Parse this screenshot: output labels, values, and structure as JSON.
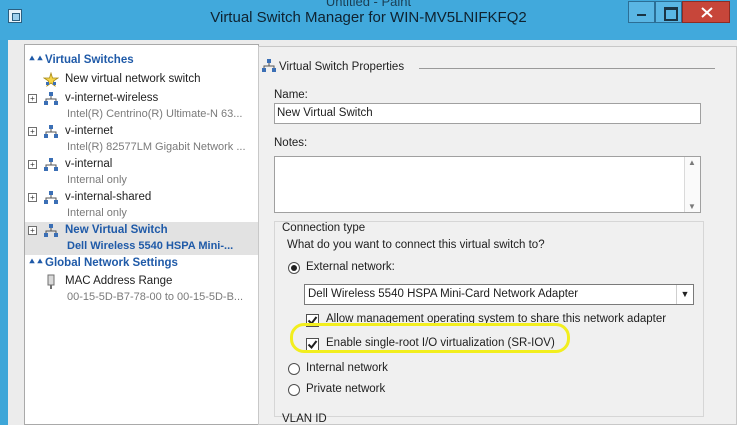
{
  "window": {
    "behind_title": "Untitled - Paint",
    "title": "Virtual Switch Manager for WIN-MV5LNIFKFQ2"
  },
  "sidebar": {
    "virtual_switches_header": "Virtual Switches",
    "new_switch_action": "New virtual network switch",
    "switches": [
      {
        "name": "v-internet-wireless",
        "detail": "Intel(R) Centrino(R) Ultimate-N 63..."
      },
      {
        "name": "v-internet",
        "detail": "Intel(R) 82577LM Gigabit Network ..."
      },
      {
        "name": "v-internal",
        "detail": "Internal only"
      },
      {
        "name": "v-internal-shared",
        "detail": "Internal only"
      },
      {
        "name": "New Virtual Switch",
        "detail": "Dell Wireless 5540 HSPA Mini-..."
      }
    ],
    "global_header": "Global Network Settings",
    "mac_range": {
      "name": "MAC Address Range",
      "detail": "00-15-5D-B7-78-00 to 00-15-5D-B..."
    }
  },
  "properties": {
    "title": "Virtual Switch Properties",
    "name_label": "Name:",
    "name_value": "New Virtual Switch",
    "notes_label": "Notes:",
    "connection_type_label": "Connection type",
    "question": "What do you want to connect this virtual switch to?",
    "external_label": "External network:",
    "adapter_selected": "Dell Wireless 5540 HSPA Mini-Card Network Adapter",
    "allow_mgmt_label": "Allow management operating system to share this network adapter",
    "sriov_label": "Enable single-root I/O virtualization (SR-IOV)",
    "internal_label": "Internal network",
    "private_label": "Private network",
    "vlan_label": "VLAN ID",
    "allow_mgmt_checked": true,
    "sriov_checked": true,
    "external_selected": true
  },
  "colors": {
    "titlebar": "#41a9dc",
    "selected_text": "#1f5aa8",
    "highlight": "#f2ee1e"
  }
}
